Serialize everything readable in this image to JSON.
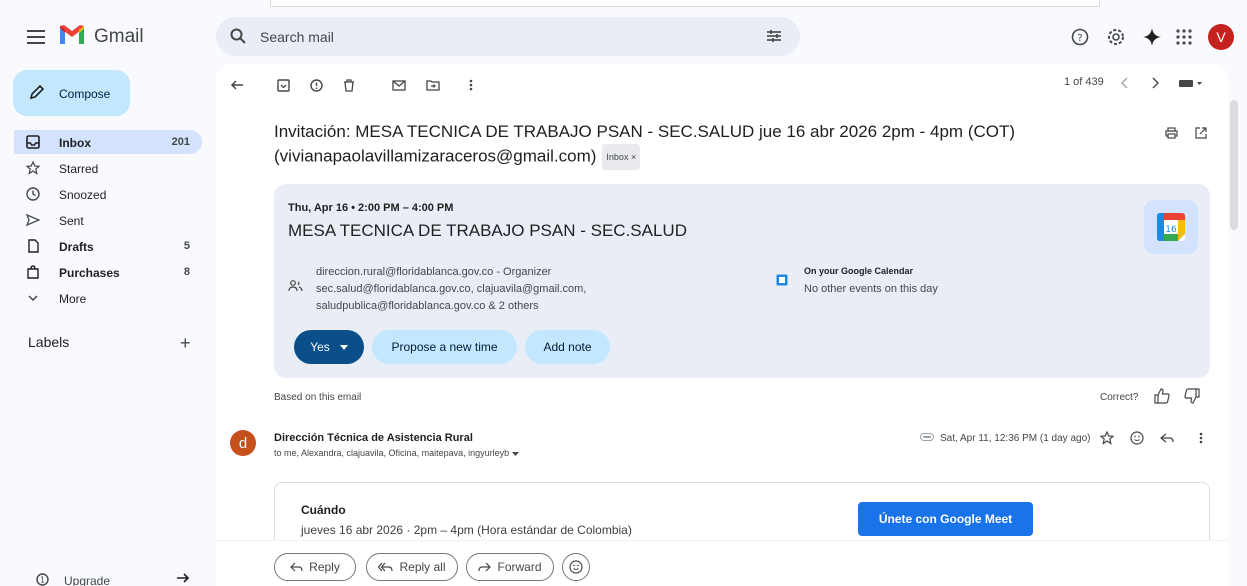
{
  "app": {
    "brand": "Gmail",
    "avatar_letter": "V"
  },
  "search": {
    "placeholder": "Search mail"
  },
  "compose": {
    "label": "Compose"
  },
  "nav": [
    {
      "label": "Inbox",
      "count": "201",
      "icon": "inbox-icon",
      "bold": true,
      "active": true
    },
    {
      "label": "Starred",
      "count": "",
      "icon": "star-icon"
    },
    {
      "label": "Snoozed",
      "count": "",
      "icon": "clock-icon"
    },
    {
      "label": "Sent",
      "count": "",
      "icon": "send-icon"
    },
    {
      "label": "Drafts",
      "count": "5",
      "icon": "draft-icon",
      "bold": true
    },
    {
      "label": "Purchases",
      "count": "8",
      "icon": "purchases-icon",
      "bold": true
    },
    {
      "label": "More",
      "count": "",
      "icon": "chevron-down-icon"
    }
  ],
  "labels": {
    "title": "Labels",
    "add": "+"
  },
  "upgrade": {
    "label": "Upgrade"
  },
  "toolbar": {
    "pager": "1 of 439"
  },
  "email": {
    "subject_line1": "Invitación: MESA TECNICA DE TRABAJO PSAN - SEC.SALUD jue 16 abr 2026 2pm - 4pm (COT)",
    "subject_line2": "(vivianapaolavillamizaraceros@gmail.com)",
    "inbox_chip": "Inbox ×",
    "event": {
      "date": "Thu, Apr 16 • 2:00 PM – 4:00 PM",
      "title": "MESA TECNICA DE TRABAJO PSAN - SEC.SALUD",
      "calendar_day": "16",
      "people": [
        "direccion.rural@floridablanca.gov.co - Organizer",
        "sec.salud@floridablanca.gov.co, clajuavila@gmail.com,",
        "saludpublica@floridablanca.gov.co & 2 others"
      ],
      "cal_label": "On your Google Calendar",
      "cal_status": "No other events on this day",
      "yes": "Yes",
      "propose": "Propose a new time",
      "note": "Add note"
    },
    "based_on": "Based on this email",
    "correct": "Correct?",
    "sender_initial": "d",
    "sender": "Dirección Técnica de Asistencia Rural",
    "recipients": "to me, Alexandra, clajuavila, Oficina, maitepava, ingyurleyb",
    "date": "Sat, Apr 11, 12:36 PM (1 day ago)",
    "body": {
      "cuando_label": "Cuándo",
      "cuando_value": "jueves 16 abr 2026 · 2pm – 4pm (Hora estándar de Colombia)",
      "meet_button": "Únete con Google Meet"
    },
    "reply": {
      "reply": "Reply",
      "reply_all": "Reply all",
      "forward": "Forward"
    }
  },
  "colors": {
    "accent": "#0b57d0",
    "compose_bg": "#c2e7ff",
    "active_nav": "#d3e3fd",
    "card_bg": "#e9eef6",
    "meet_btn": "#1a73e8"
  }
}
